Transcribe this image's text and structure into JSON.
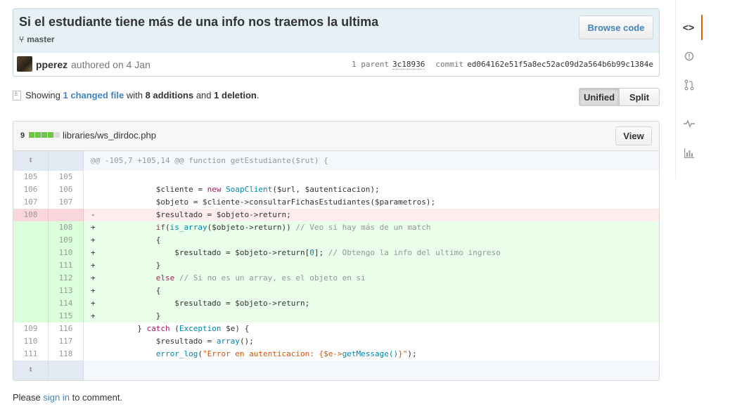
{
  "commit": {
    "title": "Si el estudiante tiene más de una info nos traemos la ultima",
    "branch": "master",
    "browse_label": "Browse code",
    "author": "pperez",
    "authored": "authored on 4 Jan",
    "parent_label": "1 parent",
    "parent_sha": "3c18936",
    "commit_label": "commit",
    "commit_sha": "ed064162e51f5a8ec52ac09d2a564b6b99c1384e"
  },
  "sidebar": {
    "items": [
      {
        "icon": "code-icon",
        "glyph": "<>"
      },
      {
        "icon": "issue-icon",
        "glyph": "!"
      },
      {
        "icon": "pull-request-icon",
        "glyph": "⇅"
      },
      {
        "icon": "pulse-icon",
        "glyph": "⌇"
      },
      {
        "icon": "graph-icon",
        "glyph": "▥"
      }
    ]
  },
  "toc": {
    "showing": "Showing",
    "changed": "1 changed file",
    "with": "with",
    "additions": "8 additions",
    "and": "and",
    "deletions": "1 deletion",
    "period": "."
  },
  "view_toggle": {
    "unified": "Unified",
    "split": "Split"
  },
  "file": {
    "changes": "9",
    "name": "libraries/ws_dirdoc.php",
    "view_label": "View",
    "diffstat_colors": [
      "#6cc644",
      "#6cc644",
      "#6cc644",
      "#6cc644",
      "#ddd"
    ]
  },
  "diff": {
    "hunk": "@@ -105,7 +105,14 @@ function getEstudiante($rut) {",
    "lines": [
      {
        "type": "ctx",
        "old": "105",
        "new": "105",
        "code": ""
      },
      {
        "type": "ctx",
        "old": "106",
        "new": "106",
        "code": "              $cliente = new SoapClient($url, $autenticacion);"
      },
      {
        "type": "ctx",
        "old": "107",
        "new": "107",
        "code": "              $objeto = $cliente->consultarFichasEstudiantes($parametros);"
      },
      {
        "type": "del",
        "old": "108",
        "new": "",
        "code": "-             $resultado = $objeto->return;"
      },
      {
        "type": "add",
        "old": "",
        "new": "108",
        "code": "+             if(is_array($objeto->return)) // Veo si hay más de un match"
      },
      {
        "type": "add",
        "old": "",
        "new": "109",
        "code": "+             {"
      },
      {
        "type": "add",
        "old": "",
        "new": "110",
        "code": "+                 $resultado = $objeto->return[0]; // Obtengo la info del ultimo ingreso"
      },
      {
        "type": "add",
        "old": "",
        "new": "111",
        "code": "+             }"
      },
      {
        "type": "add",
        "old": "",
        "new": "112",
        "code": "+             else // Si no es un array, es el objeto en si"
      },
      {
        "type": "add",
        "old": "",
        "new": "113",
        "code": "+             {"
      },
      {
        "type": "add",
        "old": "",
        "new": "114",
        "code": "+                 $resultado = $objeto->return;"
      },
      {
        "type": "add",
        "old": "",
        "new": "115",
        "code": "+             }"
      },
      {
        "type": "ctx",
        "old": "109",
        "new": "116",
        "code": "          } catch (Exception $e) {"
      },
      {
        "type": "ctx",
        "old": "110",
        "new": "117",
        "code": "              $resultado = array();"
      },
      {
        "type": "ctx",
        "old": "111",
        "new": "118",
        "code": "              error_log(\"Error en autenticacion: {$e->getMessage()}\");"
      }
    ]
  },
  "comment": {
    "please": "Please",
    "sign_in": "sign in",
    "to_comment": "to comment."
  }
}
